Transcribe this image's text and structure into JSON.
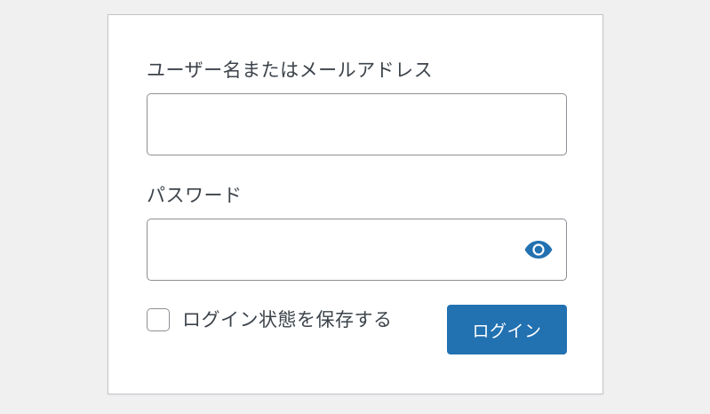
{
  "login_form": {
    "username_label": "ユーザー名またはメールアドレス",
    "username_value": "",
    "password_label": "パスワード",
    "password_value": "",
    "show_password_icon": "eye-icon",
    "remember_checked": false,
    "remember_label": "ログイン状態を保存する",
    "submit_label": "ログイン"
  },
  "colors": {
    "page_background": "#f0f0f1",
    "card_background": "#ffffff",
    "accent": "#2271b1",
    "label_text": "#3c434a",
    "input_border": "#8c8f94"
  }
}
